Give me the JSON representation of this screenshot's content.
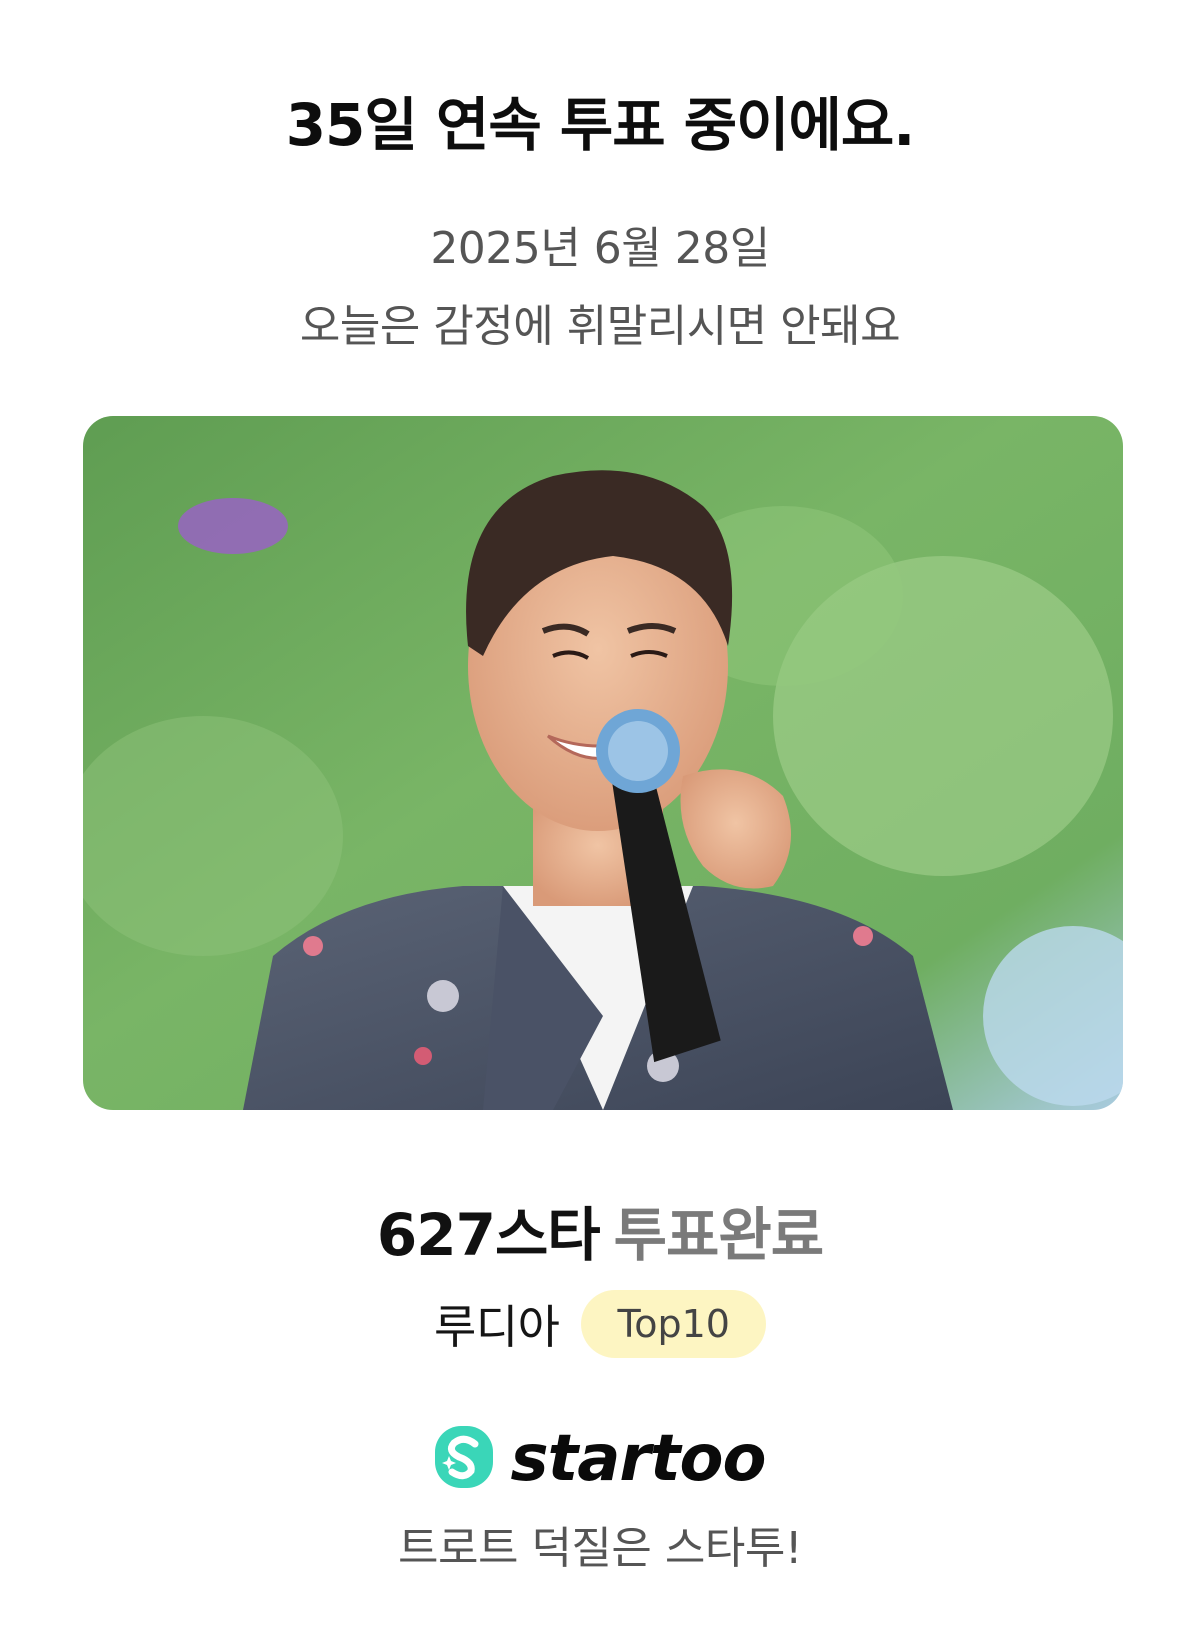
{
  "header": {
    "title": "35일 연속 투표 중이에요.",
    "date": "2025년 6월 28일",
    "message": "오늘은 감정에 휘말리시면 안돼요"
  },
  "result": {
    "star_name": "627스타",
    "status": "투표완료"
  },
  "rank": {
    "app_name": "루디아",
    "badge": "Top10",
    "badge_color": "#fdf5c2"
  },
  "brand": {
    "logo_icon": "startoo-s-logo-icon",
    "name": "startoo",
    "accent_color": "#3ad6b8",
    "slogan": "트로트 덕질은 스타투!"
  }
}
